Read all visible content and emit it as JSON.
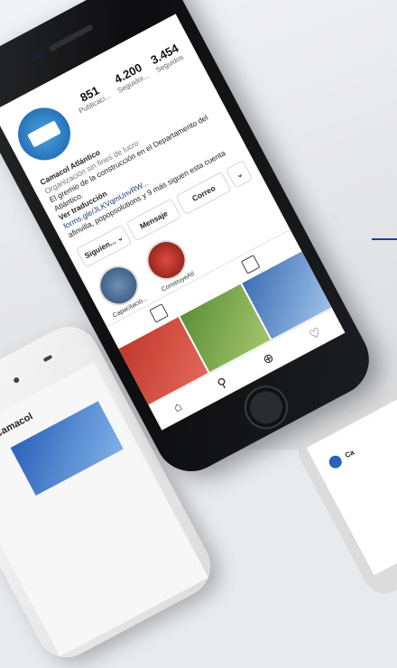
{
  "profile": {
    "stats": [
      {
        "value": "851",
        "label": "Publicaci..."
      },
      {
        "value": "4.200",
        "label": "Seguidor..."
      },
      {
        "value": "3.454",
        "label": "Seguidos"
      }
    ],
    "name": "Camacol Atlántico",
    "category": "Organización sin fines de lucro",
    "bio_line1": "El gremio de la construcción en el Departamento del Atlántico.",
    "bio_translate": "Ver traducción",
    "bio_link": "forms.gle/JLKVqmUnvRW...",
    "bio_follow": "afinvilla, popopsolutions y 9 más siguen esta cuenta"
  },
  "buttons": {
    "following": "Siguien... ⌄",
    "message": "Mensaje",
    "email": "Correo",
    "more": "⌄"
  },
  "highlights": [
    {
      "label": "Capacitació..."
    },
    {
      "label": "ConstruyeAtl"
    }
  ],
  "grid_cells": [
    {
      "label": "grid-post-1"
    },
    {
      "label": "grid-post-2"
    },
    {
      "label": "grid-post-3"
    }
  ],
  "nav": {
    "home": "⌂",
    "search": "⚲",
    "add": "⊕",
    "heart": "♡"
  },
  "phone2": {
    "name": "Camacol"
  },
  "phone3": {
    "name": "Ca"
  }
}
